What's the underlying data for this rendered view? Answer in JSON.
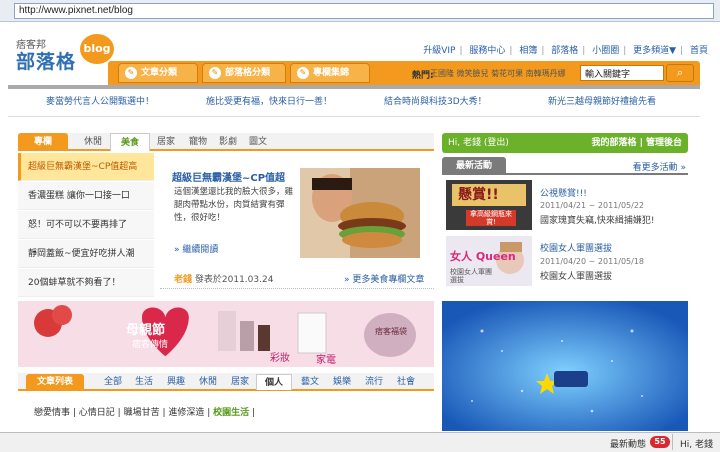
{
  "browser": {
    "url": "http://www.pixnet.net/blog"
  },
  "logo": {
    "small": "痞客邦",
    "big": "部落格",
    "badge": "blog"
  },
  "topnav": {
    "items": [
      "升級VIP",
      "服務中心",
      "相簿",
      "部落格",
      "小圈圈",
      "更多頻道▼",
      "首頁"
    ]
  },
  "navtabs": [
    {
      "label": "文章分類",
      "icon": "article-icon"
    },
    {
      "label": "部落格分類",
      "icon": "blog-icon"
    },
    {
      "label": "專欄集錦",
      "icon": "column-icon"
    }
  ],
  "search": {
    "hot_label": "熱門:",
    "hot_words": "王國隆 微笑臉兒 菊花可果 南韓瑪丹娜",
    "placeholder": "輸入關鍵字",
    "button": "⌕"
  },
  "promos": [
    "麥當勞代言人公開甄選中！",
    "施比受更有福，快來日行一善！",
    "結合時尚與科技3D大秀！",
    "新光三越母親節好禮搶先看"
  ],
  "categories": {
    "items": [
      "專欄",
      "休閒",
      "美食",
      "居家",
      "寵物",
      "影劇",
      "圖文"
    ]
  },
  "left_list": [
    "超級巨無霸漢堡~CP值超高",
    "香濃蛋糕 讓你一口接一口",
    "怒！可不可以不要再排了",
    "靜岡蓋飯~便宜好吃拼人潮",
    "20個蚌草就不夠看了！"
  ],
  "article": {
    "title": "超級巨無霸漢堡~CP值超",
    "text": "這個漢堡還比我的臉大很多，雞腿肉帶點水份，肉質結實有彈性，很好吃！",
    "more": "» 繼續閱讀",
    "author": "老錢",
    "date_prefix": "發表於2011.03.24",
    "more_col": "» 更多美食專欄文章"
  },
  "banner": {
    "title": "母親節",
    "subtitle": "痞客傳情",
    "tag1": "彩妝",
    "tag2": "家電",
    "tag3": "痞客福袋"
  },
  "tabs2": {
    "items": [
      "文章列表",
      "全部",
      "生活",
      "興趣",
      "休閒",
      "居家",
      "個人",
      "藝文",
      "娛樂",
      "流行",
      "社會"
    ]
  },
  "subtabs": {
    "items": [
      "戀愛情事",
      "心情日記",
      "職場甘苦",
      "進修深造",
      "校園生活"
    ]
  },
  "user": {
    "greeting": "Hi, 老錢 (登出)",
    "links": "我的部落格 | 管理後台"
  },
  "events": {
    "header": "最新活動",
    "more": "看更多活動 »",
    "items": [
      {
        "title": "公視懸賞!!!",
        "date": "2011/04/21 ~ 2011/05/22",
        "desc": "國家瑰寶失竊,快來緝捕嫌犯!",
        "img_text": "懸賞!!",
        "img_sub": "拿高級鋼瓶來賞!"
      },
      {
        "title": "校園女人軍團選拔",
        "date": "2011/04/20 ~ 2011/05/18",
        "desc": "校園女人軍團選拔",
        "img_text": "女人 Queen",
        "img_sub": "校園女人軍團選拔"
      }
    ]
  },
  "statusbar": {
    "news_label": "最新動態",
    "news_count": "55",
    "user": "Hi, 老錢"
  },
  "colors": {
    "orange": "#f39a1e",
    "blue": "#2a5fa6",
    "green": "#6bb22a"
  }
}
